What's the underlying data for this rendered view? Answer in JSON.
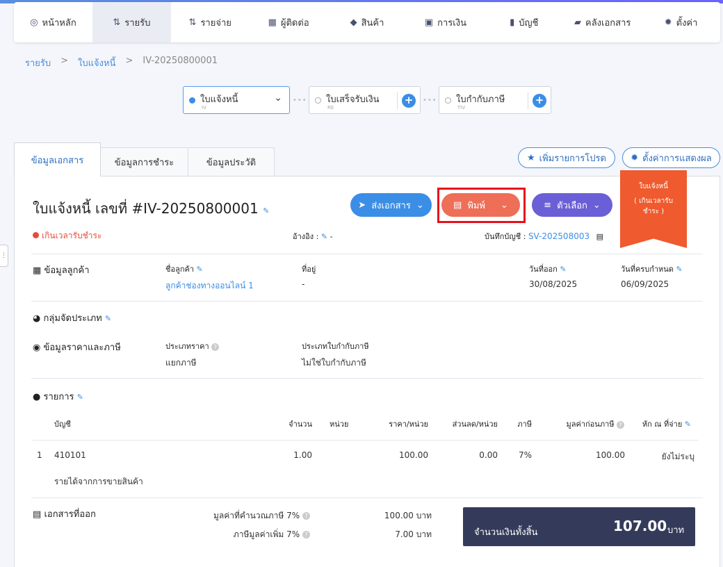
{
  "nav": {
    "items": [
      {
        "label": "หน้าหลัก",
        "icon": "dashboard-icon"
      },
      {
        "label": "รายรับ",
        "icon": "income-icon"
      },
      {
        "label": "รายจ่าย",
        "icon": "expense-icon"
      },
      {
        "label": "ผู้ติดต่อ",
        "icon": "contacts-icon"
      },
      {
        "label": "สินค้า",
        "icon": "box-icon"
      },
      {
        "label": "การเงิน",
        "icon": "money-icon"
      },
      {
        "label": "บัญชี",
        "icon": "book-icon"
      },
      {
        "label": "คลังเอกสาร",
        "icon": "folder-icon"
      },
      {
        "label": "ตั้งค่า",
        "icon": "gear-icon"
      }
    ],
    "active": "รายรับ"
  },
  "breadcrumb": {
    "root": "รายรับ",
    "section": "ใบแจ้งหนี้",
    "current": "IV-20250800001"
  },
  "flow": {
    "steps": [
      {
        "label": "ใบแจ้งหนี้",
        "code": "IV"
      },
      {
        "label": "ใบเสร็จรับเงิน",
        "code": "RE"
      },
      {
        "label": "ใบกำกับภาษี",
        "code": "TIV"
      }
    ]
  },
  "tabs": [
    "ข้อมูลเอกสาร",
    "ข้อมูลการชำระ",
    "ข้อมูลประวัติ"
  ],
  "actions": {
    "favorite": "เพิ่มรายการโปรด",
    "display_settings": "ตั้งค่าการแสดงผล"
  },
  "doc": {
    "title": "ใบแจ้งหนี้ เลขที่ #IV-20250800001",
    "send": "ส่งเอกสาร",
    "print": "พิมพ์",
    "options": "ตัวเลือก",
    "ribbon_line1": "ใบแจ้งหนี้",
    "ribbon_line2": "( เกินเวลารับ",
    "ribbon_line3": "ชำระ )",
    "status": "เกินเวลารับชำระ",
    "reference_label": "อ้างอิง :",
    "reference_value": "-",
    "journal_label": "บันทึกบัญชี :",
    "journal_value": "SV-202508003"
  },
  "customer": {
    "section": "ข้อมูลลูกค้า",
    "name_label": "ชื่อลูกค้า",
    "name": "ลูกค้าช่องทางออนไลน์ 1",
    "address_label": "ที่อยู่",
    "address": "-",
    "issue_label": "วันที่ออก",
    "issue_date": "30/08/2025",
    "due_label": "วันที่ครบกำหนด",
    "due_date": "06/09/2025"
  },
  "classification": {
    "section": "กลุ่มจัดประเภท"
  },
  "pricing": {
    "section": "ข้อมูลราคาและภาษี",
    "price_type_label": "ประเภทราคา",
    "price_type": "แยกภาษี",
    "tax_invoice_label": "ประเภทใบกำกับภาษี",
    "tax_invoice": "ไม่ใช่ใบกำกับภาษี"
  },
  "items": {
    "section": "รายการ",
    "columns": [
      "บัญชี",
      "จำนวน",
      "หน่วย",
      "ราคา/หน่วย",
      "ส่วนลด/หน่วย",
      "ภาษี",
      "มูลค่าก่อนภาษี",
      "หัก ณ ที่จ่าย"
    ],
    "rows": [
      {
        "no": "1",
        "account": "410101",
        "qty": "1.00",
        "unit": "",
        "price": "100.00",
        "discount": "0.00",
        "tax": "7%",
        "pretax": "100.00",
        "wht": "ยังไม่ระบุ",
        "desc": "รายได้จากการขายสินค้า"
      }
    ]
  },
  "summary": {
    "section": "เอกสารที่ออก",
    "taxable_label": "มูลค่าที่คำนวณภาษี 7%",
    "taxable_value": "100.00 บาท",
    "vat_label": "ภาษีมูลค่าเพิ่ม 7%",
    "vat_value": "7.00 บาท",
    "total_label": "จำนวนเงินทั้งสิ้น",
    "total_value": "107.00",
    "currency": "บาท"
  },
  "colors": {
    "primary": "#3b8ee6",
    "print": "#ee6e58",
    "options": "#6a5fd6",
    "ribbon": "#ef5a2e",
    "total_bg": "#343b5a",
    "highlight": "#e8101a"
  }
}
